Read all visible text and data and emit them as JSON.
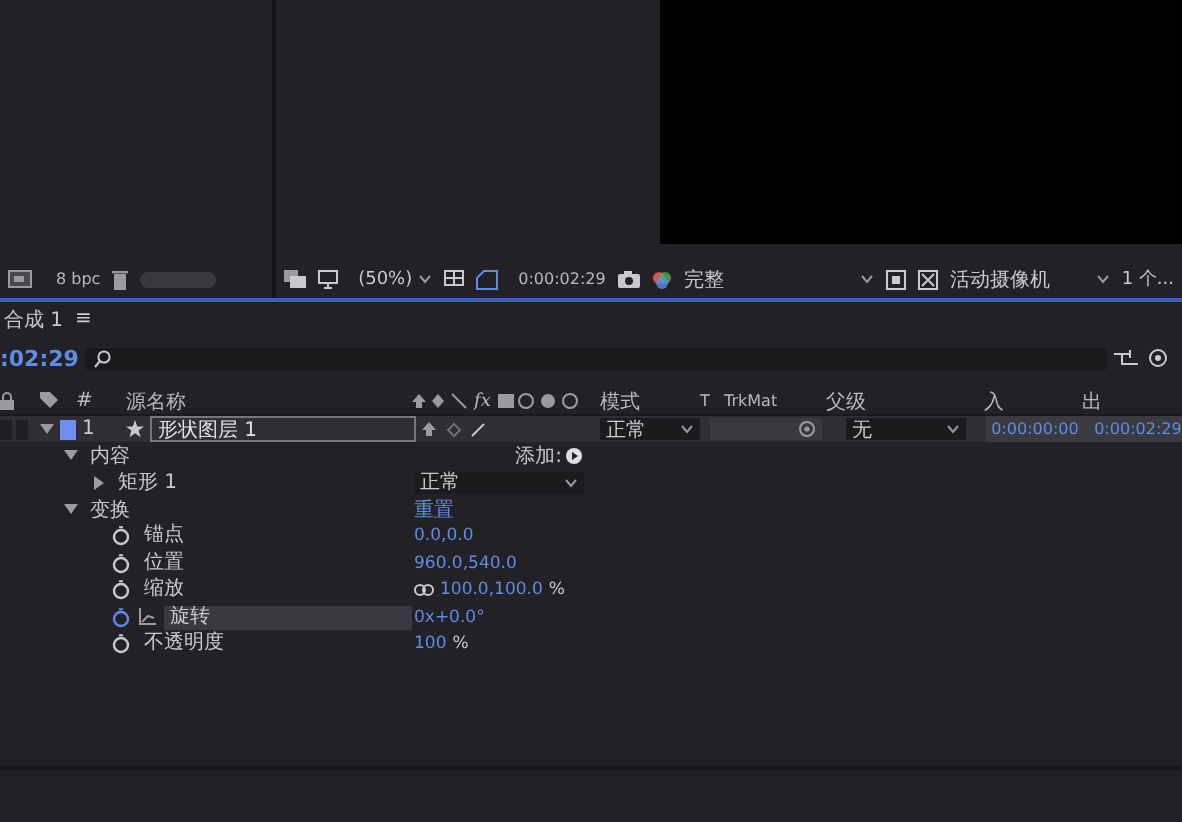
{
  "project_panel": {
    "bit_depth": "8 bpc",
    "slider": {
      "level": 1
    }
  },
  "viewer_toolbar": {
    "zoom": "(50%)",
    "timecode": "0:00:02:29",
    "resolution": "完整",
    "view": "活动摄像机",
    "view_count": "1 个..."
  },
  "timeline": {
    "tab": {
      "title": "合成 1",
      "menu": "≡"
    },
    "timecode": ":02:29",
    "effects_switch": "fx",
    "columns": [
      "#",
      "源名称",
      "模式",
      "T",
      "TrkMat",
      "父级",
      "入",
      "出"
    ],
    "layers": [
      {
        "number": "1",
        "name": "形状图层 1",
        "mode": "正常",
        "parent": "无",
        "in": "0:00:00:00",
        "out": "0:00:02:29",
        "selected": true,
        "expanded": true,
        "groups": [
          {
            "name": "内容",
            "expanded": true,
            "value": "添加:",
            "children": [
              {
                "name": "矩形 1",
                "expanded": false,
                "value": "正常"
              }
            ]
          },
          {
            "name": "变换",
            "expanded": true,
            "value": "重置",
            "properties": [
              {
                "name": "锚点",
                "value": "0.0,0.0",
                "selected": false
              },
              {
                "name": "位置",
                "value": "960.0,540.0",
                "selected": false
              },
              {
                "name": "缩放",
                "value": "100.0,100.0",
                "unit": "%",
                "selected": false
              },
              {
                "name": "旋转",
                "value": "0x+0.0°",
                "selected": true
              },
              {
                "name": "不透明度",
                "value": "100",
                "unit": "%",
                "selected": false
              }
            ]
          }
        ]
      }
    ]
  }
}
